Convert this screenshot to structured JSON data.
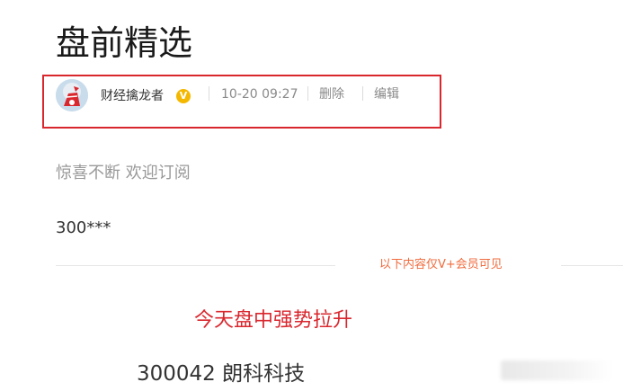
{
  "article": {
    "title": "盘前精选",
    "intro": "惊喜不断 欢迎订阅",
    "code_teaser": "300***",
    "vip_notice": "以下内容仅V+会员可见",
    "headline": "今天盘中强势拉升",
    "stock": "300042 朗科科技"
  },
  "meta": {
    "author": "财经擒龙者",
    "verified_badge": "V",
    "timestamp": "10-20 09:27",
    "delete_label": "删除",
    "edit_label": "编辑"
  },
  "colors": {
    "highlight_box": "#d9272e",
    "headline": "#d9272e",
    "vip_notice": "#f06b3d",
    "badge": "#f5b800"
  },
  "icons": {
    "avatar": "avatar-icon",
    "verified": "verified-badge-icon"
  }
}
